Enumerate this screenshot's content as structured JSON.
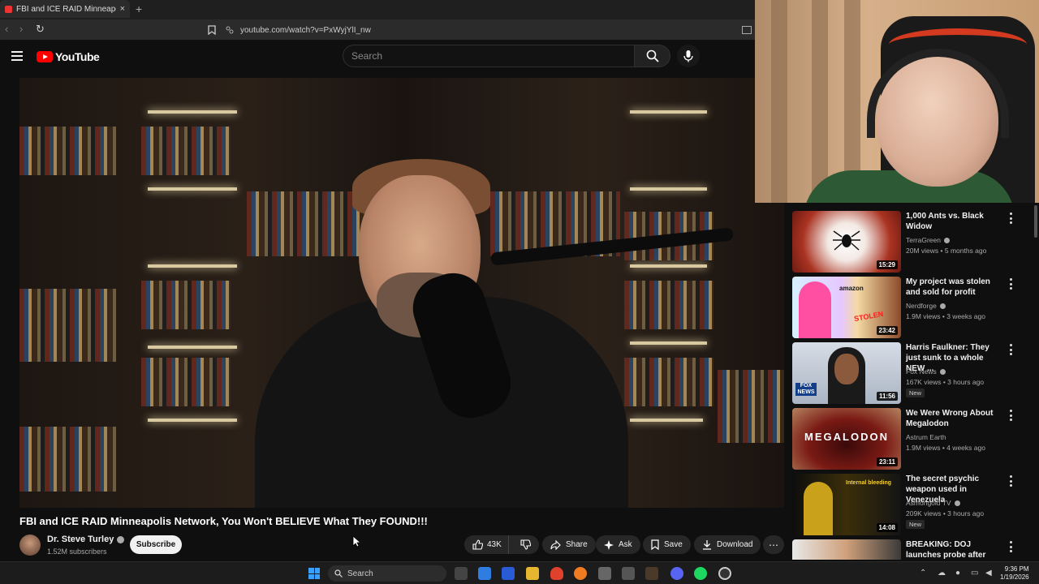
{
  "browser": {
    "tab_title": "FBI and ICE RAID Minneapolis",
    "new_tab": "+",
    "tab_close": "×",
    "url": "youtube.com/watch?v=PxWyjYlI_nw"
  },
  "youtube": {
    "logo_text": "YouTube",
    "search_placeholder": "Search"
  },
  "video": {
    "title": "FBI and ICE RAID Minneapolis Network, You Won't BELIEVE What They FOUND!!!",
    "channel": "Dr. Steve Turley",
    "subscribers": "1.52M subscribers",
    "subscribe_label": "Subscribe",
    "likes": "43K",
    "share_label": "Share",
    "ask_label": "Ask",
    "save_label": "Save",
    "download_label": "Download"
  },
  "recommendations": [
    {
      "title": "1,000 Ants vs. Black Widow",
      "channel": "TerraGreen",
      "meta": "20M views • 5 months ago",
      "duration": "15:29",
      "badge": "",
      "verified": true
    },
    {
      "title": "My project was stolen and sold for profit",
      "channel": "Nerdforge",
      "meta": "1.9M views • 3 weeks ago",
      "duration": "23:42",
      "badge": "",
      "verified": true
    },
    {
      "title": "Harris Faulkner: They just sunk to a whole NEW ...",
      "channel": "Fox News",
      "meta": "167K views • 3 hours ago",
      "duration": "11:56",
      "badge": "New",
      "verified": true
    },
    {
      "title": "We Were Wrong About Megalodon",
      "channel": "Astrum Earth",
      "meta": "1.9M views • 4 weeks ago",
      "duration": "23:11",
      "badge": "",
      "verified": false
    },
    {
      "title": "The secret psychic weapon used in Venezuela",
      "channel": "Asmongold TV",
      "meta": "209K views • 3 hours ago",
      "duration": "14:08",
      "badge": "New",
      "verified": true
    },
    {
      "title": "BREAKING: DOJ launches probe after anti-ICE ...",
      "channel": "",
      "meta": "",
      "duration": "",
      "badge": "",
      "verified": false
    }
  ],
  "thumb_texts": {
    "t2_a": "amazon",
    "t2_b": "STOLEN",
    "t3": "FOX NEWS",
    "t4": "MEGALODON",
    "t5": "Internal bleeding"
  },
  "taskbar": {
    "search_label": "Search",
    "time": "9:36 PM",
    "date": "1/19/2026"
  },
  "colors": {
    "accent": "#ff0000",
    "background": "#0f0f0f"
  }
}
